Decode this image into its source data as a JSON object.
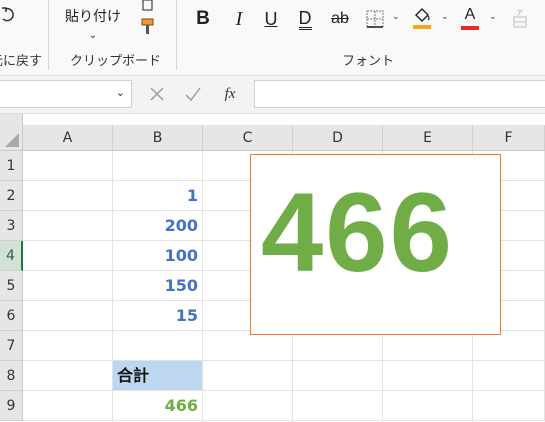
{
  "ribbon": {
    "undo_group_label": "元に戻す",
    "clipboard": {
      "paste_label": "貼り付け",
      "group_label": "クリップボード"
    },
    "font": {
      "group_label": "フォント",
      "bold_label": "B",
      "italic_label": "I",
      "underline_label": "U",
      "double_underline_label": "D",
      "strikethrough_label": "ab",
      "font_color_label": "A",
      "font_color": "#e32c2c",
      "fill_color": "#f5a623"
    }
  },
  "formula_bar": {
    "name_box_value": "",
    "fx_label": "fx",
    "formula_value": ""
  },
  "sheet": {
    "columns": [
      "A",
      "B",
      "C",
      "D",
      "E",
      "F"
    ],
    "rows": [
      "1",
      "2",
      "3",
      "4",
      "5",
      "6",
      "7",
      "8",
      "9"
    ],
    "active_row": "4",
    "cells": {
      "B2": "1",
      "B3": "200",
      "B4": "100",
      "B5": "150",
      "B6": "15",
      "B8": "合計",
      "B9": "466"
    },
    "shape_text": "466",
    "colors": {
      "number_blue": "#4472c4",
      "total_green": "#70ad47",
      "header_fill": "#bdd7ee",
      "shape_border": "#ed7d31"
    }
  }
}
